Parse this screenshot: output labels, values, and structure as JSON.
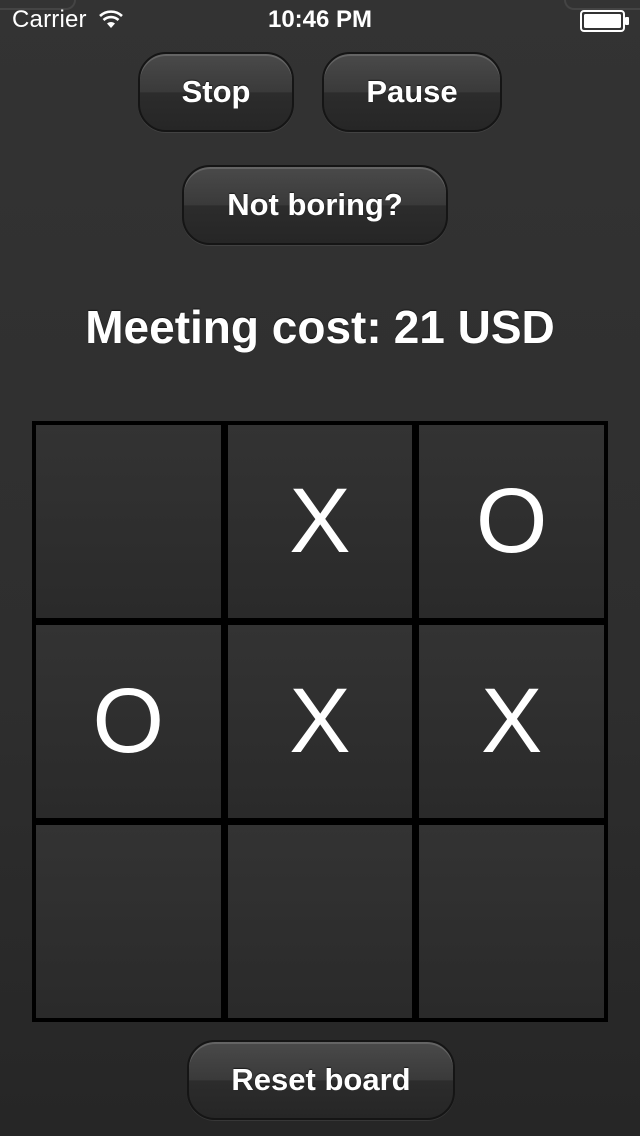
{
  "status_bar": {
    "carrier": "Carrier",
    "time": "10:46 PM",
    "wifi_icon": "wifi-icon",
    "battery_icon": "battery-icon"
  },
  "controls": {
    "stop_label": "Stop",
    "pause_label": "Pause",
    "not_boring_label": "Not boring?",
    "reset_label": "Reset board"
  },
  "meeting_cost": {
    "label": "Meeting cost:",
    "amount": "21 USD"
  },
  "board": {
    "cells": [
      "",
      "X",
      "O",
      "O",
      "X",
      "X",
      "",
      "",
      ""
    ]
  }
}
